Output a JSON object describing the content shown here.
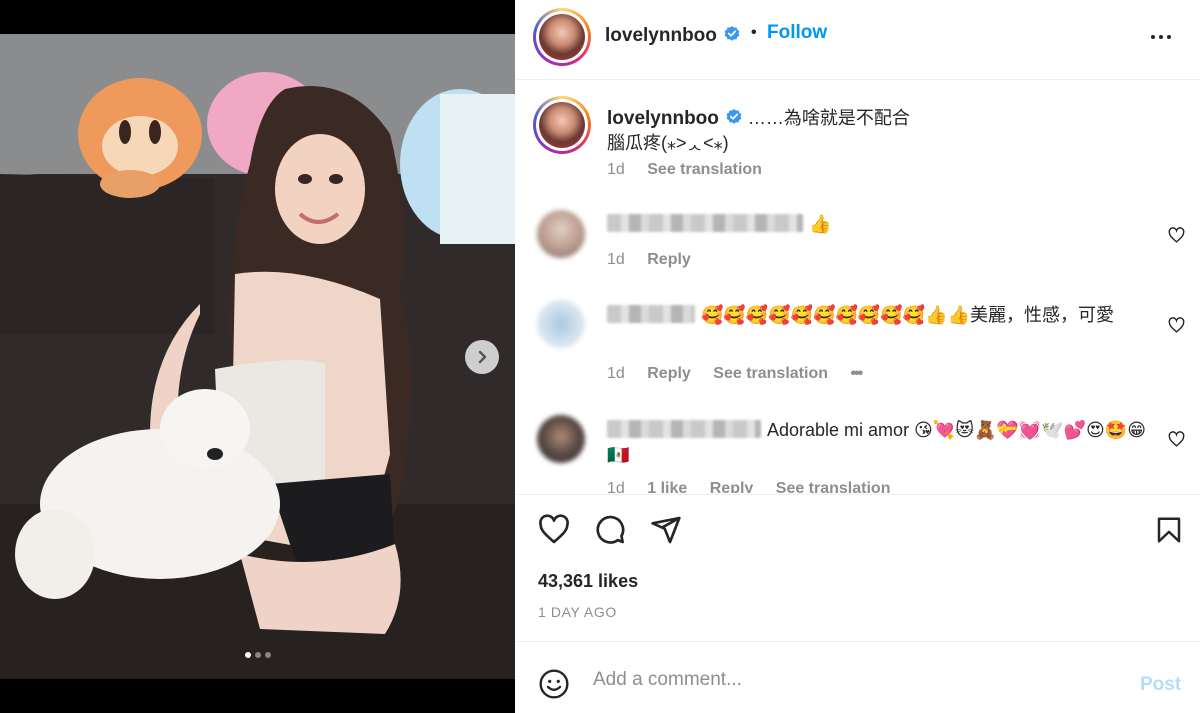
{
  "post": {
    "username": "lovelynnboo",
    "follow_label": "Follow",
    "separator": "•",
    "carousel_dots": 3,
    "active_dot": 0
  },
  "caption": {
    "username": "lovelynnboo",
    "text_line1": "……為啥就是不配合",
    "text_line2": "腦瓜疼(⁎˃ᆺ˂⁎)",
    "time": "1d",
    "translate_label": "See translation"
  },
  "comments": [
    {
      "text": "👍",
      "time": "1d",
      "reply_label": "Reply"
    },
    {
      "text": "🥰🥰🥰🥰🥰🥰🥰🥰🥰🥰👍👍美麗，性感，可愛",
      "time": "1d",
      "reply_label": "Reply",
      "translate_label": "See translation",
      "more_label": "•••"
    },
    {
      "text": "Adorable mi amor 😘💘😻🧸💝💓🕊️💕😍🤩😁🇲🇽",
      "time": "1d",
      "reply_label": "1 like",
      "reply2_label": "Reply",
      "translate_label": "See translation"
    }
  ],
  "stats": {
    "likes": "43,361 likes",
    "time_ago": "1 DAY AGO"
  },
  "composer": {
    "placeholder": "Add a comment...",
    "post_label": "Post"
  },
  "colors": {
    "accent": "#0095f6",
    "post_disabled": "#b2dffc",
    "muted": "#8e8e8e",
    "verified": "#0095f6"
  },
  "icons": [
    "verified-badge-icon",
    "more-options-icon",
    "chevron-right-icon",
    "heart-icon",
    "comment-icon",
    "share-icon",
    "bookmark-icon",
    "emoji-icon"
  ]
}
